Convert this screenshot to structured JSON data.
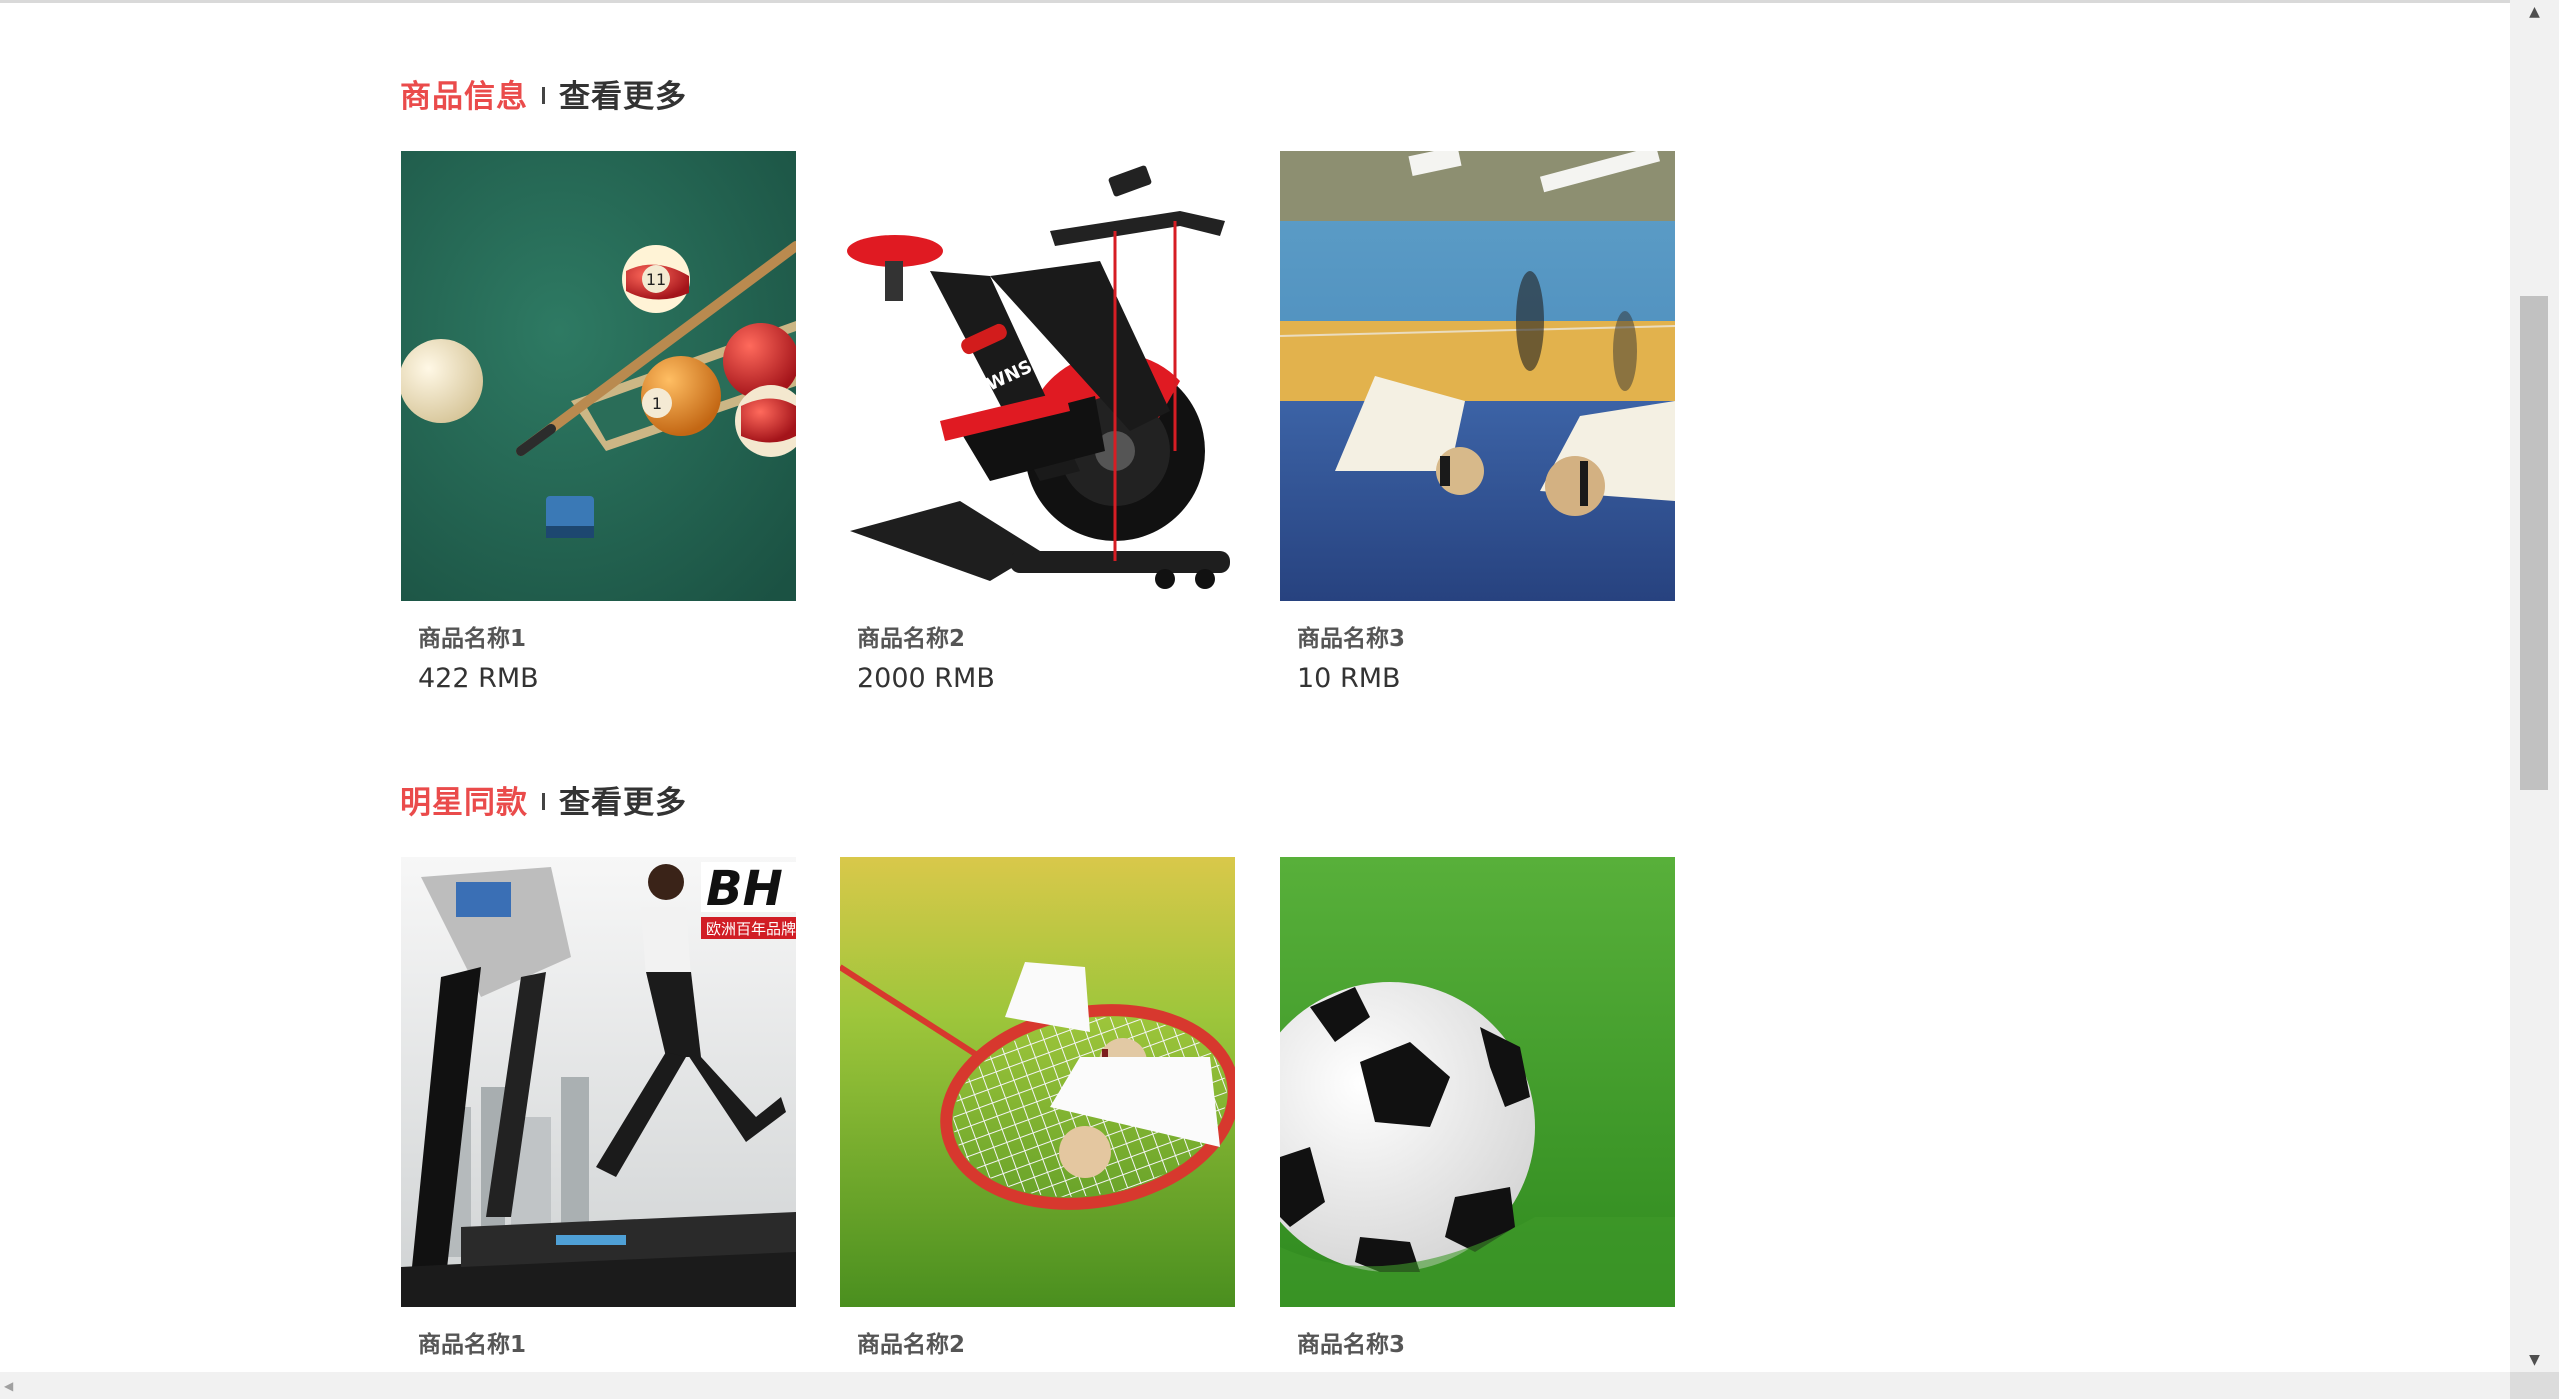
{
  "sections": [
    {
      "title": "商品信息",
      "more": "查看更多",
      "products": [
        {
          "name": "商品名称1",
          "price": "422 RMB",
          "image": "billiards-image"
        },
        {
          "name": "商品名称2",
          "price": "2000 RMB",
          "image": "exercise-bike-image"
        },
        {
          "name": "商品名称3",
          "price": "10 RMB",
          "image": "badminton-court-image"
        }
      ]
    },
    {
      "title": "明星同款",
      "more": "查看更多",
      "products": [
        {
          "name": "商品名称1",
          "price": "",
          "image": "treadmill-image",
          "brand": "BH",
          "brand_tagline": "欧洲百年品牌"
        },
        {
          "name": "商品名称2",
          "price": "",
          "image": "badminton-racket-image"
        },
        {
          "name": "商品名称3",
          "price": "",
          "image": "soccer-ball-image"
        }
      ]
    }
  ],
  "colors": {
    "accent": "#ea4b4b",
    "text": "#333333",
    "muted": "#555555"
  }
}
